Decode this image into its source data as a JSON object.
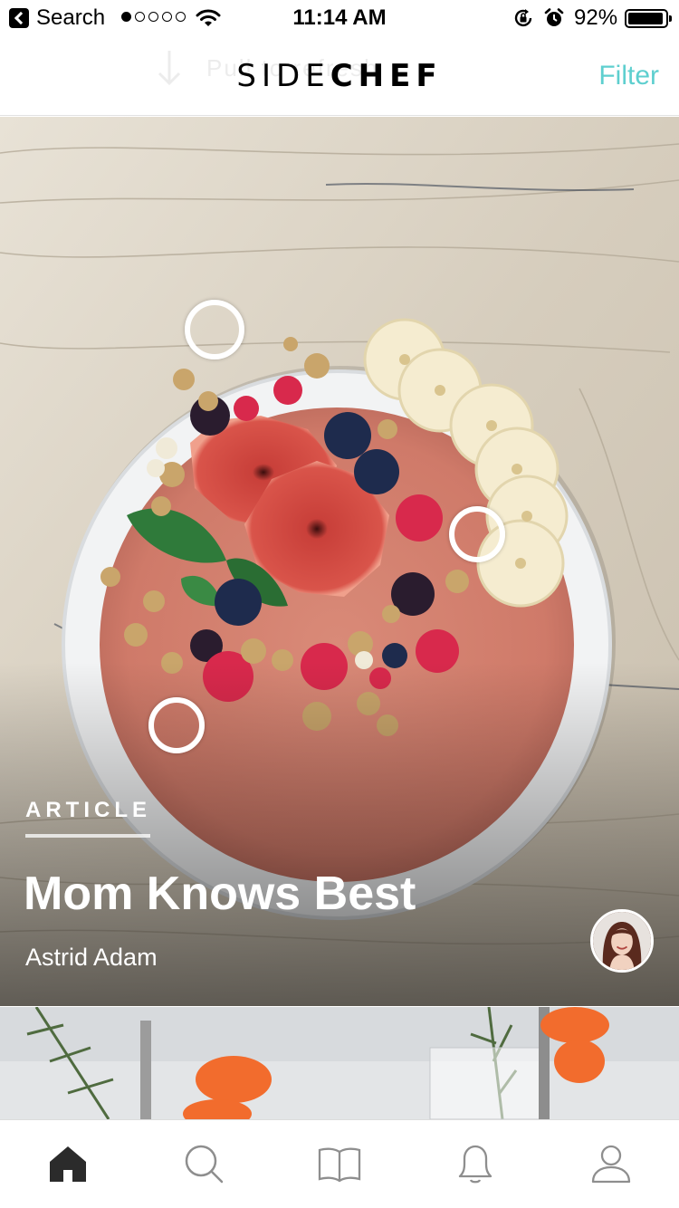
{
  "status_bar": {
    "back_label": "Search",
    "time": "11:14 AM",
    "battery": "92%",
    "signal_bars_filled": 1,
    "signal_bars_total": 5
  },
  "header": {
    "pull_hint": "Pull to refresh",
    "logo_light": "SIDE",
    "logo_bold": "CHEF",
    "filter_label": "Filter",
    "filter_color": "#5ecfcf"
  },
  "feature": {
    "category": "ARTICLE",
    "title": "Mom Knows Best",
    "author": "Astrid Adam",
    "hotspot_count": 3
  },
  "tab_bar": {
    "items": [
      {
        "name": "home",
        "icon": "home-icon",
        "active": true
      },
      {
        "name": "search",
        "icon": "search-icon",
        "active": false
      },
      {
        "name": "recipes",
        "icon": "book-icon",
        "active": false
      },
      {
        "name": "notifications",
        "icon": "bell-icon",
        "active": false
      },
      {
        "name": "profile",
        "icon": "person-icon",
        "active": false
      }
    ],
    "active_color": "#2b2b2b",
    "inactive_color": "#8e8e8e"
  }
}
